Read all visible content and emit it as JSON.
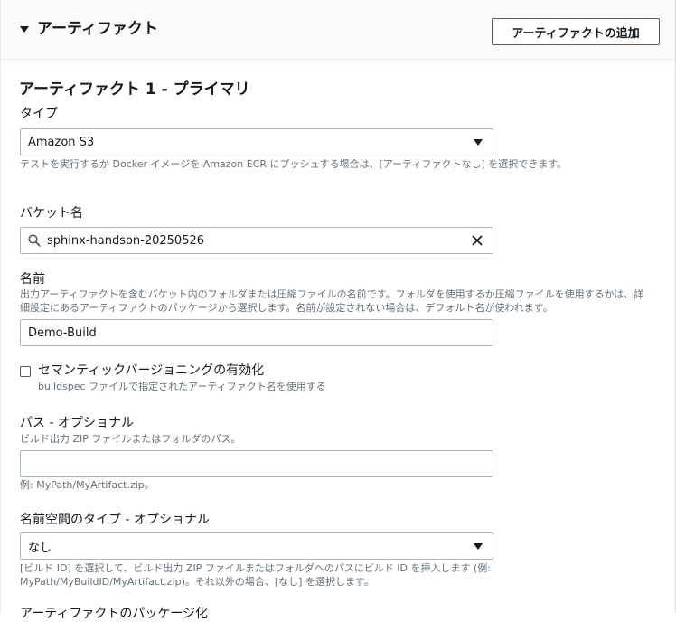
{
  "header": {
    "title": "アーティファクト",
    "add_button": "アーティファクトの追加"
  },
  "artifact": {
    "title": "アーティファクト 1 - プライマリ",
    "type": {
      "label": "タイプ",
      "value": "Amazon S3",
      "help": "テストを実行するか Docker イメージを Amazon ECR にプッシュする場合は、[アーティファクトなし] を選択できます。"
    },
    "bucket": {
      "label": "バケット名",
      "value": "sphinx-handson-20250526"
    },
    "name": {
      "label": "名前",
      "help_line1": "出力アーティファクトを含むバケット内のフォルダまたは圧縮ファイルの名前です。フォルダを使用するか圧縮ファイルを使用するかは、詳",
      "help_line2": "細設定にあるアーティファクトのパッケージから選択します。名前が設定されない場合は、デフォルト名が使われます。",
      "value": "Demo-Build"
    },
    "semantic": {
      "label": "セマンティックバージョニングの有効化",
      "help": "buildspec ファイルで指定されたアーティファクト名を使用する",
      "checked": false
    },
    "path": {
      "label": "パス - オプショナル",
      "help": "ビルド出力 ZIP ファイルまたはフォルダのパス。",
      "value": "",
      "example": "例: MyPath/MyArtifact.zip。"
    },
    "namespace": {
      "label": "名前空間のタイプ - オプショナル",
      "value": "なし",
      "help_line1": "[ビルド ID] を選択して、ビルド出力 ZIP ファイルまたはフォルダへのパスにビルド ID を挿入します (例:",
      "help_line2": "MyPath/MyBuildID/MyArtifact.zip)。それ以外の場合、[なし] を選択します。"
    },
    "packaging": {
      "label": "アーティファクトのパッケージ化"
    }
  }
}
